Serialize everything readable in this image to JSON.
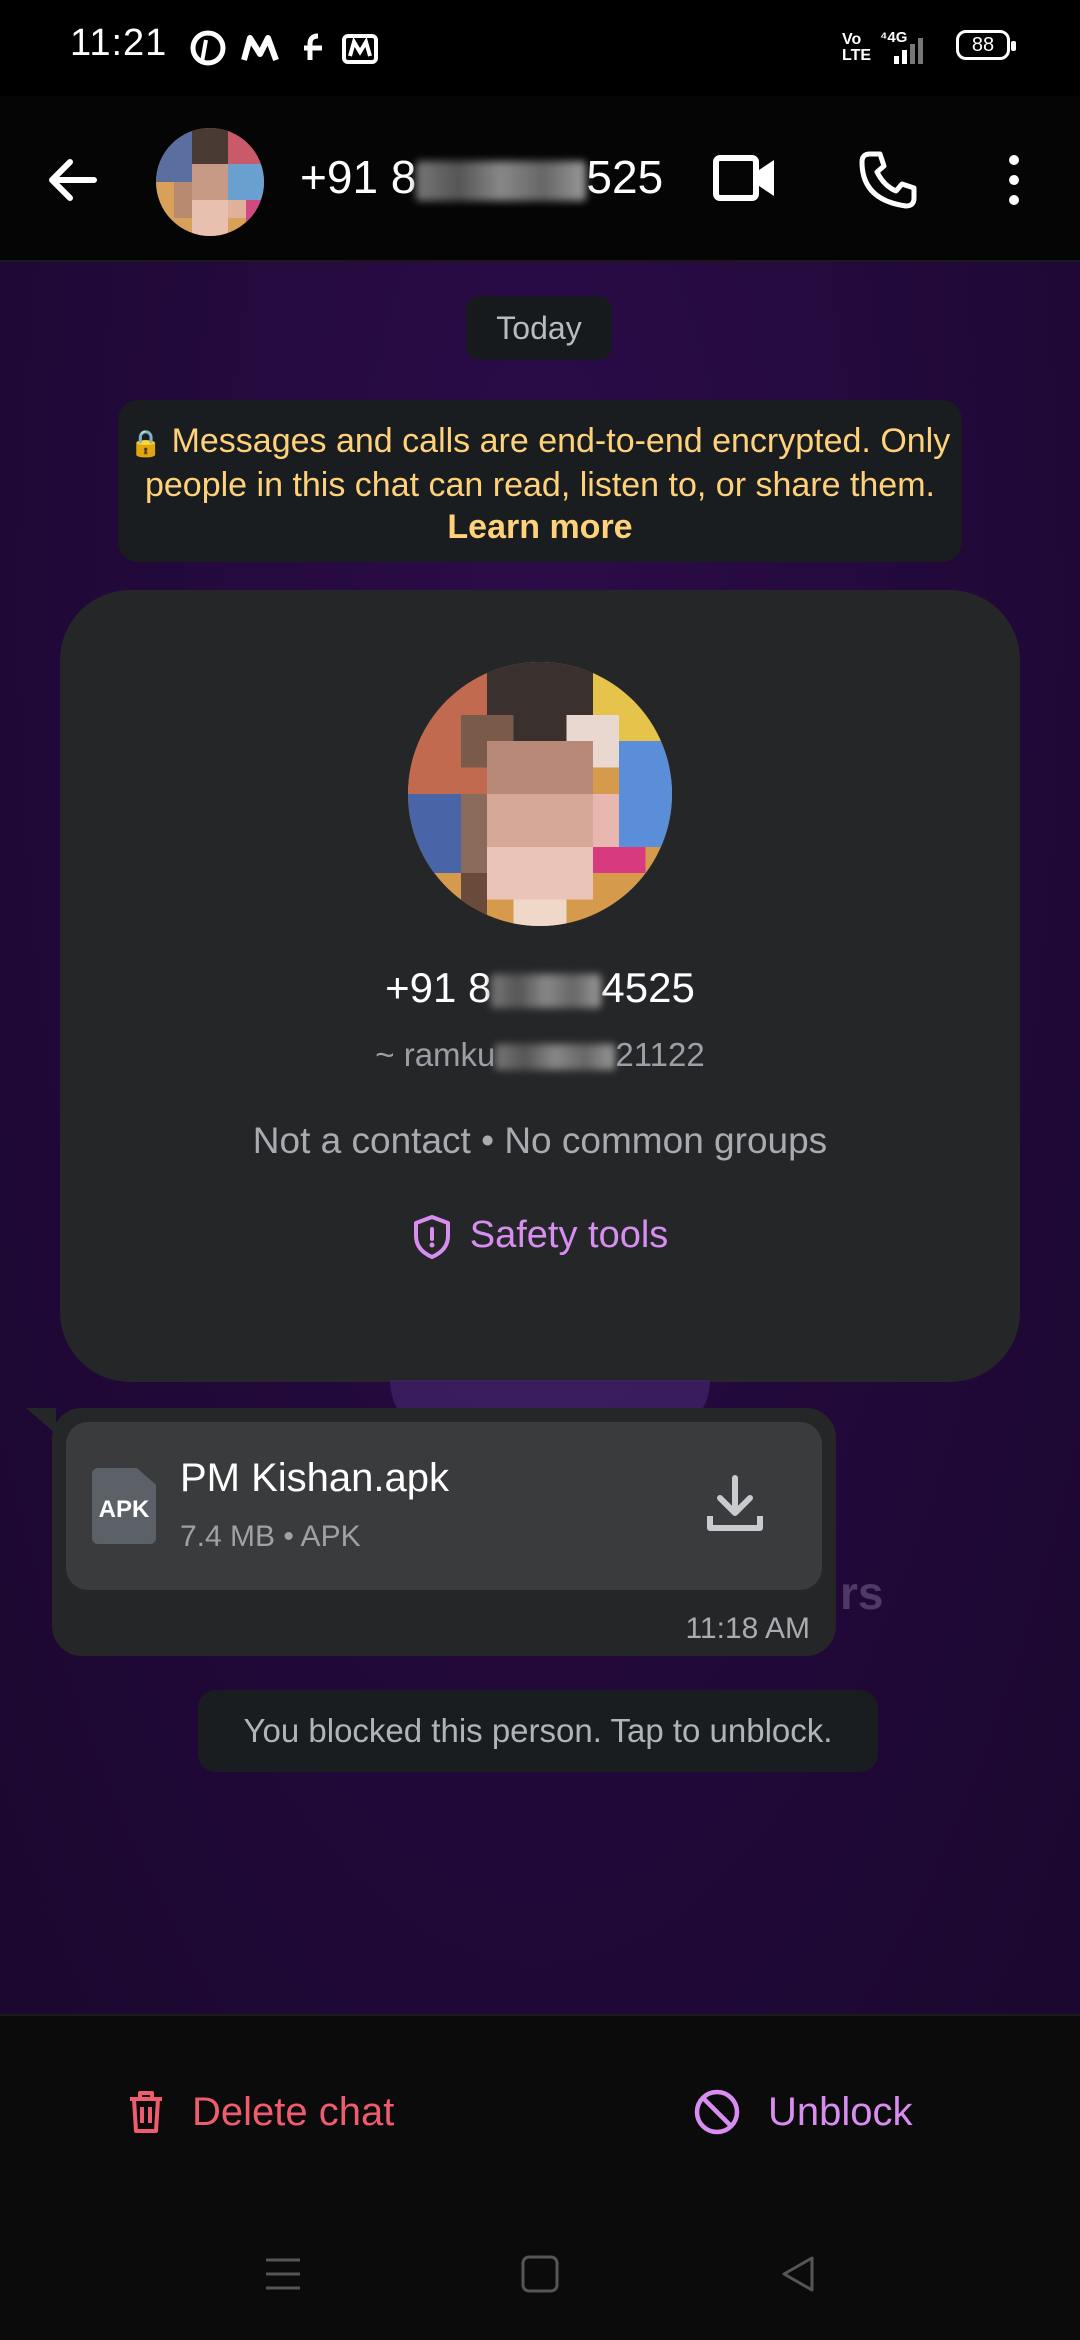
{
  "status_bar": {
    "time": "11:21",
    "battery": "88",
    "network": "4G",
    "volte": "Vo LTE"
  },
  "header": {
    "phone_prefix": "+91 8",
    "phone_suffix": "525"
  },
  "chat": {
    "date_label": "Today",
    "encryption_notice": "Messages and calls are end-to-end encrypted. Only people in this chat can read, listen to, or share them.",
    "learn_more": "Learn more",
    "profile": {
      "phone_prefix": "+91 8",
      "phone_suffix": "4525",
      "username_prefix": "~ ramku",
      "username_suffix": "21122",
      "subtitle": "Not a contact • No common groups",
      "safety_tools": "Safety tools"
    },
    "file_message": {
      "file_type_badge": "APK",
      "file_name": "PM Kishan.apk",
      "file_meta": "7.4 MB • APK",
      "time": "11:18 AM"
    },
    "ghost_text": "rs",
    "blocked_notice": "You blocked this person. Tap to unblock."
  },
  "actions": {
    "delete_label": "Delete chat",
    "unblock_label": "Unblock"
  },
  "colors": {
    "accent_purple": "#d88ef0",
    "danger_red": "#ef5c6e",
    "encryption_yellow": "#ffd279"
  }
}
